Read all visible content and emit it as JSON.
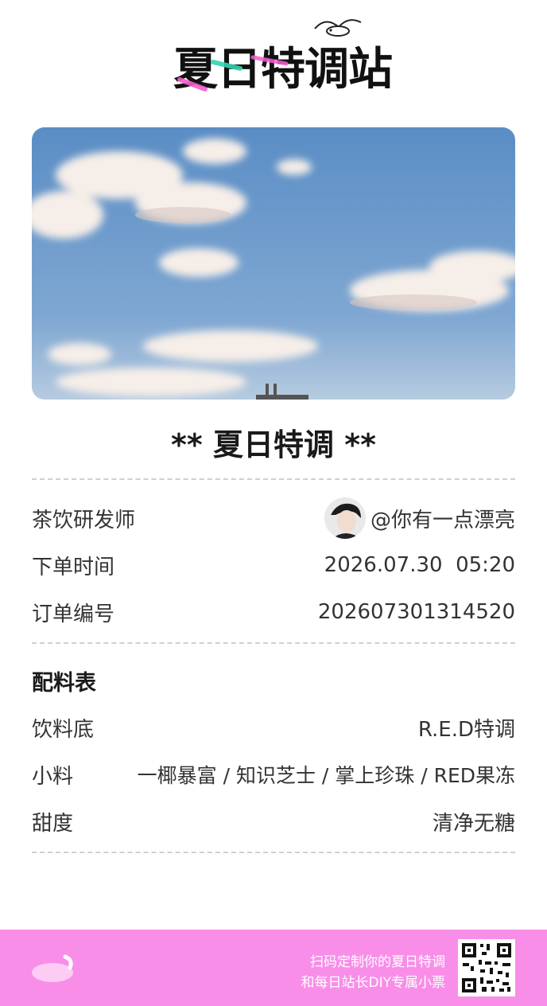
{
  "logo": {
    "text": "夏日特调站"
  },
  "receipt": {
    "title": "** 夏日特调 **",
    "info_rows": [
      {
        "label": "茶饮研发师",
        "value": "@你有一点漂亮"
      },
      {
        "label": "下单时间",
        "value": "2026.07.30  05:20"
      },
      {
        "label": "订单编号",
        "value": "202607301314520"
      }
    ],
    "ingredients": {
      "title": "配料表",
      "rows": [
        {
          "label": "饮料底",
          "value": "R.E.D特调"
        },
        {
          "label": "小料",
          "value": "一椰暴富 / 知识芝士 / 掌上珍珠 / RED果冻"
        },
        {
          "label": "甜度",
          "value": "清净无糖"
        }
      ]
    }
  },
  "footer": {
    "line1": "扫码定制你的夏日特调",
    "line2": "和每日站长DIY专属小票",
    "background": "#f98ee9"
  },
  "colors": {
    "sky_top": "#5b8ec6",
    "sky_bottom": "#a9c4df",
    "accent_pink": "#f45ccf",
    "accent_teal": "#36d3b3"
  }
}
